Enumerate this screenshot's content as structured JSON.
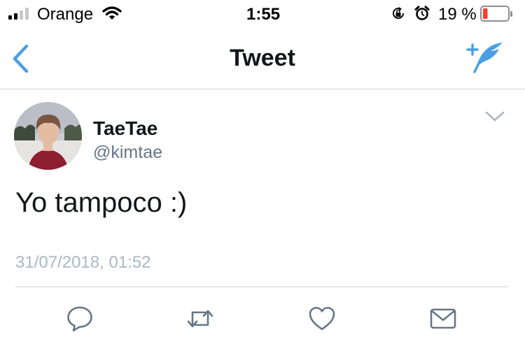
{
  "status_bar": {
    "carrier": "Orange",
    "time": "1:55",
    "battery_percent": "19 %",
    "battery_level": 0.19,
    "icons": [
      "signal-icon",
      "wifi-icon",
      "rotation-lock-icon",
      "alarm-icon",
      "battery-icon"
    ],
    "battery_color": "#ff3b30"
  },
  "nav": {
    "title": "Tweet",
    "back_icon": "chevron-left-icon",
    "compose_icon": "compose-tweet-icon",
    "accent_color": "#4a9fe4"
  },
  "tweet": {
    "author_name": "TaeTae",
    "author_handle": "@kimtae",
    "text": "Yo tampoco :)",
    "timestamp": "31/07/2018, 01:52"
  },
  "actions": [
    {
      "name": "reply",
      "icon": "reply-icon"
    },
    {
      "name": "retweet",
      "icon": "retweet-icon"
    },
    {
      "name": "like",
      "icon": "heart-icon"
    },
    {
      "name": "direct-message",
      "icon": "envelope-icon"
    }
  ]
}
